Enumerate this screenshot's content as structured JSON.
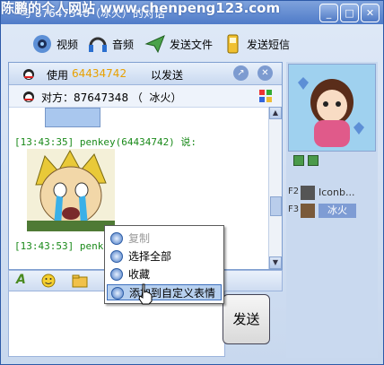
{
  "watermark": "陈鹏的个人网站 www.chenpeng123.com",
  "window": {
    "title": "与 87647348（冰火）的对话"
  },
  "title_buttons": {
    "minimize": "_",
    "maximize": "□",
    "close": "✕"
  },
  "toolbar": [
    {
      "label": "视频",
      "icon": "video-camera-icon"
    },
    {
      "label": "音频",
      "icon": "headset-icon"
    },
    {
      "label": "发送文件",
      "icon": "send-file-icon"
    },
    {
      "label": "发送短信",
      "icon": "sms-phone-icon"
    }
  ],
  "chat_header": {
    "prefix": "使用",
    "account": "64434742",
    "suffix": "以发送"
  },
  "peer": {
    "label": "对方：87647348 （  冰火）"
  },
  "messages": [
    {
      "time_line": "[13:43:35] penkey(64434742) 说:"
    },
    {
      "time_line": "[13:43:53] penkey"
    }
  ],
  "send_button": "发送",
  "context_menu": [
    {
      "label": "复制",
      "disabled": true
    },
    {
      "label": "选择全部",
      "disabled": false
    },
    {
      "label": "收藏",
      "disabled": false
    },
    {
      "label": "添加到自定义表情",
      "disabled": false
    }
  ],
  "shortcuts": [
    {
      "key": "F2",
      "label": "Iconb..."
    },
    {
      "key": "F3",
      "label": "冰火"
    }
  ],
  "colors": {
    "title": "#4f7bc8",
    "timestamp": "#1a8a1a",
    "account": "#e8a000",
    "menu_highlight": "#b7d0ef"
  }
}
